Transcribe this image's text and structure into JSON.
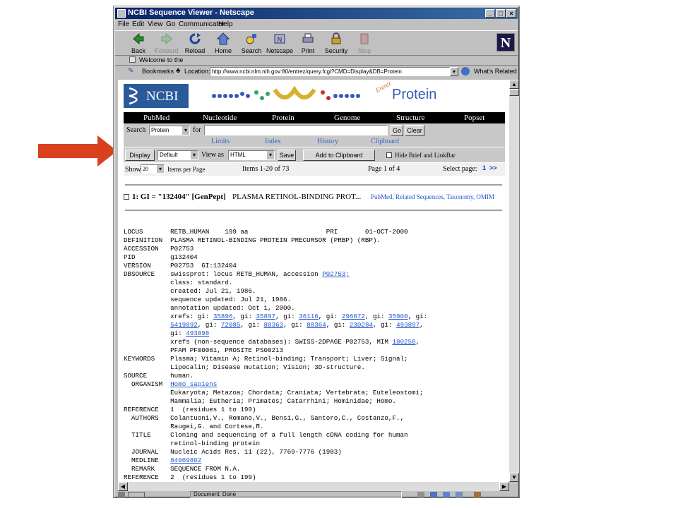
{
  "window": {
    "title": "NCBI Sequence Viewer - Netscape"
  },
  "menu": [
    "File",
    "Edit",
    "View",
    "Go",
    "Communicator",
    "Help"
  ],
  "toolbar": {
    "buttons": [
      {
        "label": "Back",
        "icon": "back-arrow-icon",
        "enabled": true
      },
      {
        "label": "Forward",
        "icon": "forward-arrow-icon",
        "enabled": false
      },
      {
        "label": "Reload",
        "icon": "reload-icon",
        "enabled": true
      },
      {
        "label": "Home",
        "icon": "home-icon",
        "enabled": true
      },
      {
        "label": "Search",
        "icon": "search-icon",
        "enabled": true
      },
      {
        "label": "Netscape",
        "icon": "netscape-icon",
        "enabled": true
      },
      {
        "label": "Print",
        "icon": "print-icon",
        "enabled": true
      },
      {
        "label": "Security",
        "icon": "lock-icon",
        "enabled": true
      },
      {
        "label": "Stop",
        "icon": "stop-icon",
        "enabled": false
      }
    ]
  },
  "personal_bar": {
    "text": "Welcome to the"
  },
  "location_bar": {
    "bookmarks": "Bookmarks",
    "location_label": "Location:",
    "url": "http://www.ncbi.nlm.nih.gov:80/entrez/query.fcgi?CMD=Display&DB=Protein",
    "whats_related": "What's Related"
  },
  "page": {
    "ncbi_logo": "NCBI",
    "entrez_logo": "Entrez",
    "protein_logo": "Protein",
    "nav": [
      "PubMed",
      "Nucleotide",
      "Protein",
      "Genome",
      "Structure",
      "Popset"
    ],
    "search": {
      "label": "Search",
      "db": "Protein",
      "for_label": "for",
      "value": "",
      "go": "Go",
      "clear": "Clear"
    },
    "links": [
      "Limits",
      "Index",
      "History",
      "Clipboard"
    ],
    "display": {
      "button": "Display",
      "format": "Default",
      "view_as_label": "View as",
      "view_as": "HTML",
      "save": "Save",
      "add_clipboard": "Add to Clipboard",
      "hide_label": "Hide Brief and LinkBar"
    },
    "show": {
      "label": "Show",
      "count": "20",
      "per_page": "Items per Page",
      "items": "Items 1-20 of 73",
      "page": "Page 1 of 4",
      "select_label": "Select page:",
      "pages": "1",
      "next": ">>"
    },
    "result": {
      "title": "1: GI = \"132404\" [GenPept]",
      "desc": "PLASMA RETINOL-BINDING PROT...",
      "links": [
        {
          "text": "PubMed"
        },
        {
          "text": ", "
        },
        {
          "text": "Related Sequences"
        },
        {
          "text": ", "
        },
        {
          "text": "Taxonomy"
        },
        {
          "text": ", "
        },
        {
          "text": "OMIM"
        }
      ]
    },
    "record": [
      [
        {
          "t": "LOCUS       RETB_HUMAN    199 aa                    PRI       01-OCT-2000"
        }
      ],
      [
        {
          "t": "DEFINITION  PLASMA RETINOL-BINDING PROTEIN PRECURSOR (PRBP) (RBP)."
        }
      ],
      [
        {
          "t": "ACCESSION   P02753"
        }
      ],
      [
        {
          "t": "PID         g132404"
        }
      ],
      [
        {
          "t": "VERSION     P02753  GI:132404"
        }
      ],
      [
        {
          "t": "DBSOURCE    swissprot: locus RETB_HUMAN, accession "
        },
        {
          "t": "P02753;",
          "link": true
        }
      ],
      [
        {
          "t": "            class: standard."
        }
      ],
      [
        {
          "t": "            created: Jul 21, 1986."
        }
      ],
      [
        {
          "t": "            sequence updated: Jul 21, 1986."
        }
      ],
      [
        {
          "t": "            annotation updated: Oct 1, 2000."
        }
      ],
      [
        {
          "t": "            xrefs: gi: "
        },
        {
          "t": "35896",
          "link": true
        },
        {
          "t": ", gi: "
        },
        {
          "t": "35897",
          "link": true
        },
        {
          "t": ", gi: "
        },
        {
          "t": "36116",
          "link": true
        },
        {
          "t": ", gi: "
        },
        {
          "t": "296672",
          "link": true
        },
        {
          "t": ", gi: "
        },
        {
          "t": "35900",
          "link": true
        },
        {
          "t": ", gi:"
        }
      ],
      [
        {
          "t": "            "
        },
        {
          "t": "5419892",
          "link": true
        },
        {
          "t": ", gi: "
        },
        {
          "t": "72085",
          "link": true
        },
        {
          "t": ", gi: "
        },
        {
          "t": "88363",
          "link": true
        },
        {
          "t": ", gi: "
        },
        {
          "t": "88364",
          "link": true
        },
        {
          "t": ", gi: "
        },
        {
          "t": "230284",
          "link": true
        },
        {
          "t": ", gi: "
        },
        {
          "t": "493897",
          "link": true
        },
        {
          "t": ","
        }
      ],
      [
        {
          "t": "            gi: "
        },
        {
          "t": "493898",
          "link": true
        }
      ],
      [
        {
          "t": "            xrefs (non-sequence databases): SWISS-2DPAGE P02753, MIM "
        },
        {
          "t": "180250",
          "link": true
        },
        {
          "t": ","
        }
      ],
      [
        {
          "t": "            PFAM PF00061, PROSITE PS00213"
        }
      ],
      [
        {
          "t": "KEYWORDS    Plasma; Vitamin A; Retinol-binding; Transport; Liver; Signal;"
        }
      ],
      [
        {
          "t": "            Lipocalin; Disease mutation; Vision; 3D-structure."
        }
      ],
      [
        {
          "t": "SOURCE      human."
        }
      ],
      [
        {
          "t": "  ORGANISM  "
        },
        {
          "t": "Homo sapiens",
          "link": true
        }
      ],
      [
        {
          "t": "            Eukaryota; Metazoa; Chordata; Craniata; Vertebrata; Euteleostomi;"
        }
      ],
      [
        {
          "t": "            Mammalia; Eutheria; Primates; Catarrhini; Hominidae; Homo."
        }
      ],
      [
        {
          "t": "REFERENCE   1  (residues 1 to 199)"
        }
      ],
      [
        {
          "t": "  AUTHORS   Colantuoni,V., Romano,V., Bensi,G., Santoro,C., Costanzo,F.,"
        }
      ],
      [
        {
          "t": "            Raugei,G. and Cortese,R."
        }
      ],
      [
        {
          "t": "  TITLE     Cloning and sequencing of a full length cDNA coding for human"
        }
      ],
      [
        {
          "t": "            retinol-binding protein"
        }
      ],
      [
        {
          "t": "  JOURNAL   Nucleic Acids Res. 11 (22), 7769-7776 (1983)"
        }
      ],
      [
        {
          "t": "  MEDLINE   "
        },
        {
          "t": "84069802",
          "link": true
        }
      ],
      [
        {
          "t": "  REMARK    SEQUENCE FROM N.A."
        }
      ],
      [
        {
          "t": "REFERENCE   2  (residues 1 to 199)"
        }
      ]
    ]
  },
  "status": {
    "text": "Document: Done"
  },
  "colors": {
    "accent_arrow": "#d9401e",
    "link": "#2255cc",
    "title_bar": "#0a246a"
  }
}
